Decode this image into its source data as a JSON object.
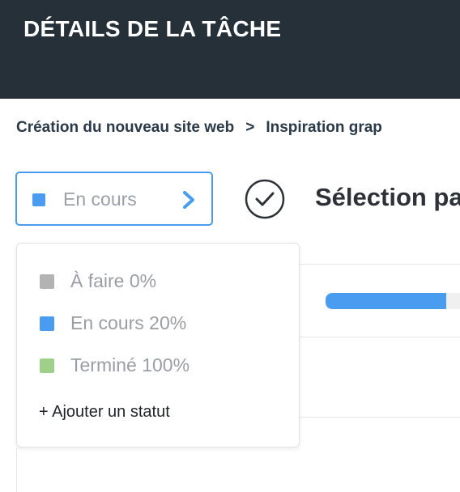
{
  "header": {
    "title": "DÉTAILS DE LA TÂCHE"
  },
  "breadcrumb": {
    "items": [
      "Création du nouveau site web",
      "Inspiration grap"
    ],
    "separator": ">"
  },
  "status_select": {
    "current": "En cours",
    "color": "#4a9cf0",
    "icon": "chevron-right-icon"
  },
  "task": {
    "title": "Sélection pa",
    "complete_icon": "check-circle-icon"
  },
  "progress": {
    "label_fragment": ":",
    "percent": 20,
    "color": "#4a9cf0"
  },
  "status_menu": {
    "options": [
      {
        "label": "À faire 0%",
        "color": "#b3b3b3"
      },
      {
        "label": "En cours 20%",
        "color": "#4a9cf0"
      },
      {
        "label": "Terminé 100%",
        "color": "#9fd08a"
      }
    ],
    "add_label": "+ Ajouter un statut"
  }
}
